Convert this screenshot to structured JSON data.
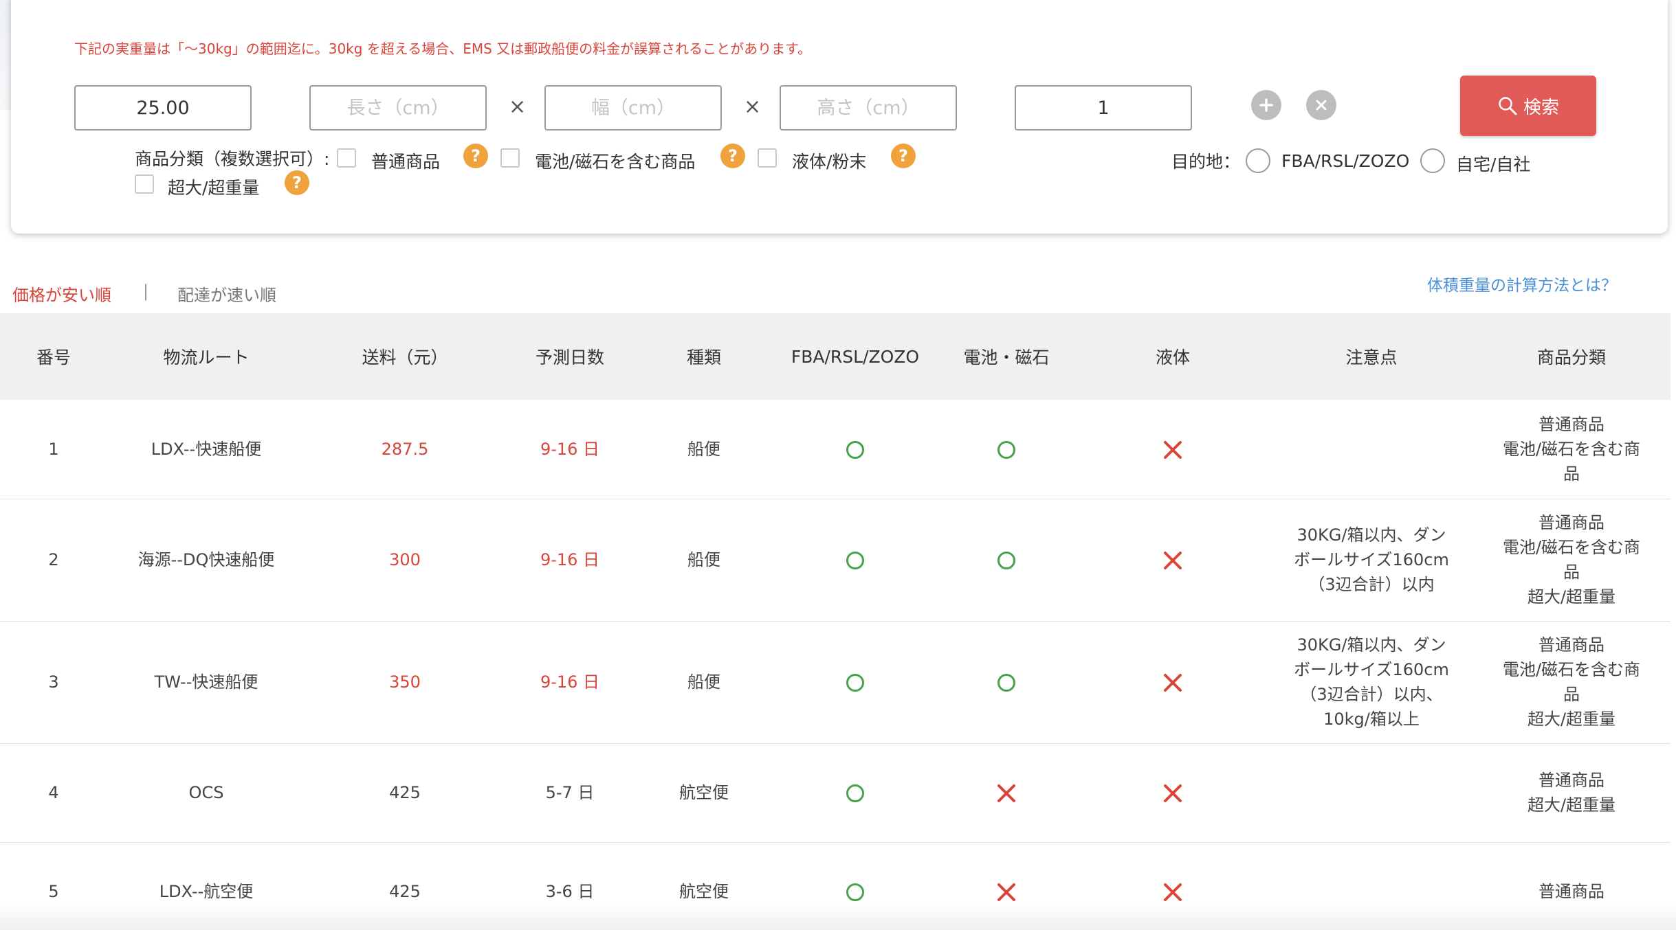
{
  "notice": "下記の実重量は「〜30kg」の範囲迄に。30kg を超える場合、EMS 又は郵政船便の料金が誤算されることがあります。",
  "inputs": {
    "weight_value": "25.00",
    "length_placeholder": "長さ（cm）",
    "width_placeholder": "幅（cm）",
    "height_placeholder": "高さ（cm）",
    "times_symbol": "×",
    "quantity_value": "1"
  },
  "search_label": "検索",
  "category": {
    "label": "商品分類（複数選択可）:",
    "options": [
      "普通商品",
      "電池/磁石を含む商品",
      "液体/粉末",
      "超大/超重量"
    ],
    "help": "?"
  },
  "destination": {
    "label": "目的地：",
    "options": [
      "FBA/RSL/ZOZO",
      "自宅/自社"
    ]
  },
  "sort": {
    "active": "価格が安い順",
    "separator": "|",
    "other": "配達が速い順"
  },
  "calc_link": "体積重量の計算方法とは？",
  "table": {
    "headers": [
      "番号",
      "物流ルート",
      "送料（元）",
      "予測日数",
      "種類",
      "FBA/RSL/ZOZO",
      "電池・磁石",
      "液体",
      "注意点",
      "商品分類"
    ],
    "rows": [
      {
        "no": "1",
        "route": "LDX--快速船便",
        "fee": "287.5",
        "days": "9-16 日",
        "type": "船便",
        "fba": true,
        "battery": true,
        "liquid": false,
        "notes": [],
        "categories": [
          "普通商品",
          "電池/磁石を含む商",
          "品"
        ]
      },
      {
        "no": "2",
        "route": "海源--DQ快速船便",
        "fee": "300",
        "days": "9-16 日",
        "type": "船便",
        "fba": true,
        "battery": true,
        "liquid": false,
        "notes": [
          "30KG/箱以内、ダン",
          "ボールサイズ160cm",
          "（3辺合計）以内"
        ],
        "categories": [
          "普通商品",
          "電池/磁石を含む商",
          "品",
          "超大/超重量"
        ]
      },
      {
        "no": "3",
        "route": "TW--快速船便",
        "fee": "350",
        "days": "9-16 日",
        "type": "船便",
        "fba": true,
        "battery": true,
        "liquid": false,
        "notes": [
          "30KG/箱以内、ダン",
          "ボールサイズ160cm",
          "（3辺合計）以内、",
          "10kg/箱以上"
        ],
        "categories": [
          "普通商品",
          "電池/磁石を含む商",
          "品",
          "超大/超重量"
        ]
      },
      {
        "no": "4",
        "route": "OCS",
        "fee": "425",
        "days": "5-7 日",
        "type": "航空便",
        "fba": true,
        "battery": false,
        "liquid": false,
        "notes": [],
        "categories": [
          "普通商品",
          "超大/超重量"
        ]
      },
      {
        "no": "5",
        "route": "LDX--航空便",
        "fee": "425",
        "days": "3-6 日",
        "type": "航空便",
        "fba": true,
        "battery": false,
        "liquid": false,
        "notes": [],
        "categories": [
          "普通商品"
        ]
      }
    ]
  },
  "colors": {
    "accent_red": "#d9453a",
    "button_red": "#e05b57",
    "ok_green": "#46a34a",
    "help_orange": "#f0a33c",
    "link_blue": "#4a90d9"
  }
}
